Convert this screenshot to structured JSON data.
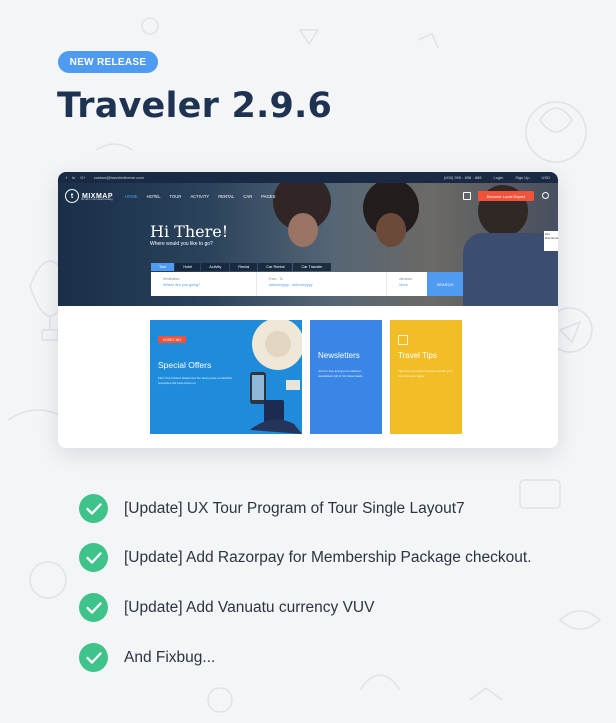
{
  "badge": "NEW RELEASE",
  "title": "Traveler 2.9.6",
  "screenshot": {
    "topbar": {
      "email": "contact@travelertheme.com",
      "phone": "(000) 999 - 898 - 888",
      "login": "Login",
      "signup": "Sign Up",
      "currency": "USD"
    },
    "nav": {
      "logo": "MIXMAP",
      "logo_initial": "t",
      "tagline": "the all in one travel booking",
      "menu": [
        "HOME",
        "HOTEL",
        "TOUR",
        "ACTIVITY",
        "RENTAL",
        "CAR",
        "PAGES"
      ],
      "cta": "Become Local Expert"
    },
    "hero": {
      "heading": "Hi There!",
      "subheading": "Where would you like to go?",
      "tabs": [
        "Tour",
        "Hotel",
        "Activity",
        "Rental",
        "Car Rental",
        "Car Transfer"
      ],
      "fields": [
        {
          "label": "Destination",
          "value": "Where are you going?"
        },
        {
          "label": "From - To",
          "value": "dd/mm/yyyy - dd/mm/yyyy"
        },
        {
          "label": "Advance",
          "value": "More"
        }
      ],
      "search_button": "SEARCH",
      "side_label": "20+ Discounts"
    },
    "cards": [
      {
        "tag": "HONEY MIX",
        "title": "Special Offers",
        "text": "Find Your Perfect Hotels Get the best prices on 20,000+ properties the best prices on"
      },
      {
        "title": "Newsletters",
        "text": "Join for free and get our tailored newsletters full of hot travel deals"
      },
      {
        "title": "Travel Tips",
        "text": "Tips from our travel experts to make your next trip even better"
      }
    ]
  },
  "updates": [
    "[Update] UX Tour Program of Tour Single Layout7",
    "[Update] Add Razorpay for Membership Package checkout.",
    "[Update] Add Vanuatu currency VUV",
    "And Fixbug..."
  ],
  "colors": {
    "accent_blue": "#4f9bf2",
    "title_navy": "#1e3352",
    "check_green": "#3ec38a",
    "cta_red": "#f0533a",
    "card_yellow": "#f2be28"
  }
}
